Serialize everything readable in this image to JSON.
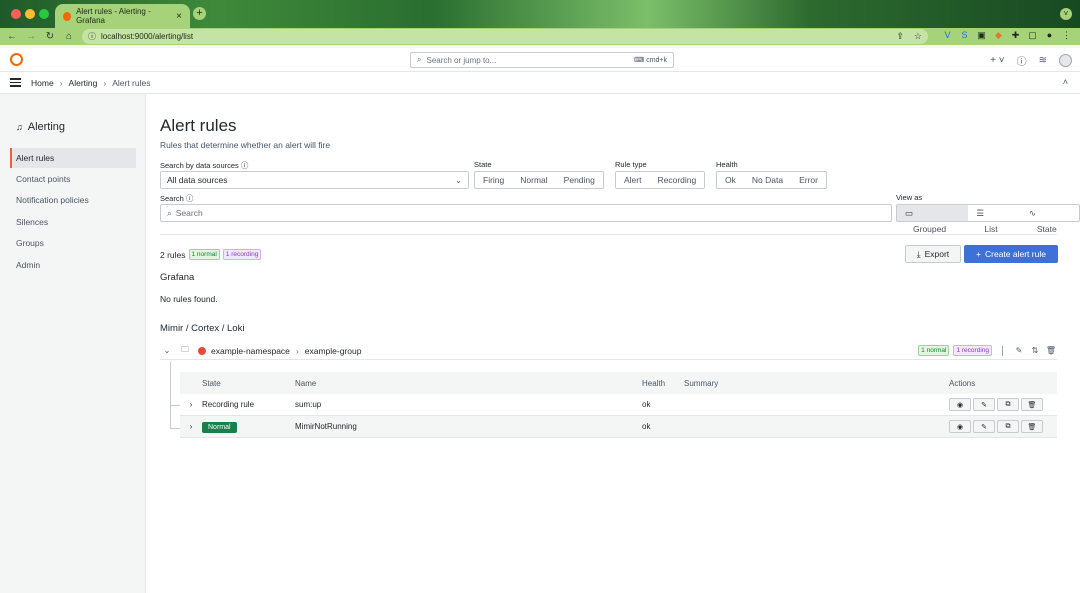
{
  "browser": {
    "tab_title": "Alert rules - Alerting - Grafana",
    "tab_close": "×",
    "new_tab": "+",
    "url": "localhost:9000/alerting/list"
  },
  "topbar": {
    "search_placeholder": "Search or jump to...",
    "shortcut": "cmd+k",
    "add_label": "+ ˅"
  },
  "breadcrumb": {
    "home": "Home",
    "alerting": "Alerting",
    "current": "Alert rules",
    "separator": "›"
  },
  "sidebar": {
    "title": "Alerting",
    "items": [
      {
        "label": "Alert rules",
        "active": true
      },
      {
        "label": "Contact points"
      },
      {
        "label": "Notification policies"
      },
      {
        "label": "Silences"
      },
      {
        "label": "Groups"
      },
      {
        "label": "Admin"
      }
    ]
  },
  "page": {
    "title": "Alert rules",
    "subtitle": "Rules that determine whether an alert will fire"
  },
  "filters": {
    "datasource_label": "Search by data sources",
    "datasource_value": "All data sources",
    "state_label": "State",
    "state_options": [
      "Firing",
      "Normal",
      "Pending"
    ],
    "rule_type_label": "Rule type",
    "rule_type_options": [
      "Alert",
      "Recording"
    ],
    "health_label": "Health",
    "health_options": [
      "Ok",
      "No Data",
      "Error"
    ],
    "search_label": "Search",
    "search_placeholder": "Search",
    "view_label": "View as",
    "view_options": [
      "Grouped",
      "List",
      "State"
    ]
  },
  "summary": {
    "count": "2 rules",
    "normal_badge": "1 normal",
    "recording_badge": "1 recording",
    "export_label": "Export",
    "create_label": "Create alert rule"
  },
  "sections": {
    "grafana": "Grafana",
    "no_rules": "No rules found.",
    "mimir": "Mimir / Cortex / Loki"
  },
  "group": {
    "namespace": "example-namespace",
    "name": "example-group",
    "normal_badge": "1 normal",
    "recording_badge": "1 recording"
  },
  "table": {
    "headers": {
      "state": "State",
      "name": "Name",
      "health": "Health",
      "summary": "Summary",
      "actions": "Actions"
    },
    "rows": [
      {
        "state": "Recording rule",
        "name": "sum:up",
        "health": "ok",
        "summary": ""
      },
      {
        "state": "Normal",
        "name": "MimirNotRunning",
        "health": "ok",
        "summary": ""
      }
    ]
  }
}
